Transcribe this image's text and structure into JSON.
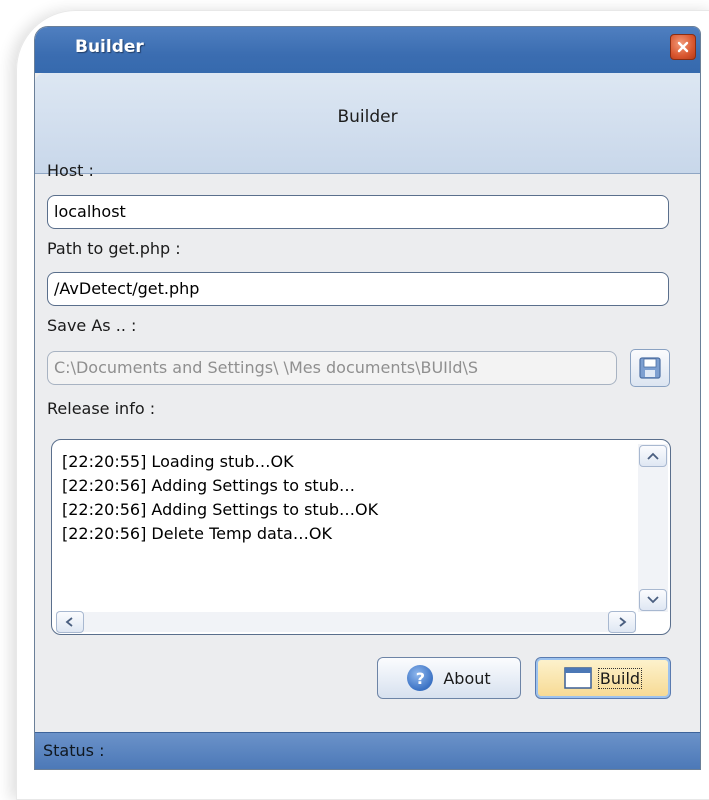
{
  "window": {
    "title": "Builder",
    "close_icon": "close-icon",
    "accent": "#3b6db1"
  },
  "header": {
    "title": "Builder"
  },
  "form": {
    "host_label": "Host :",
    "host_value": "localhost",
    "path_label": "Path to get.php :",
    "path_value": "/AvDetect/get.php",
    "save_label": "Save As .. :",
    "save_value": "C:\\Documents and Settings\\        \\Mes documents\\BUIld\\S",
    "save_button_icon": "floppy-disk-icon",
    "release_label": "Release info :"
  },
  "log": {
    "lines": [
      "[22:20:55] Loading stub…OK",
      "[22:20:56] Adding Settings to stub…",
      "[22:20:56] Adding Settings to stub…OK",
      "[22:20:56] Delete Temp data…OK"
    ]
  },
  "buttons": {
    "about_label": "About",
    "about_icon": "help-icon",
    "build_label": "Build",
    "build_icon": "window-icon"
  },
  "status": {
    "text": "Status :"
  }
}
